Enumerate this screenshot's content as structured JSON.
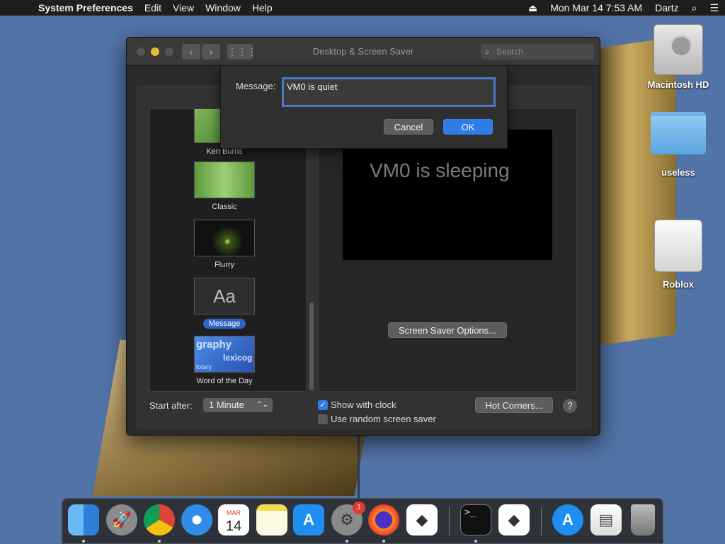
{
  "menubar": {
    "app_name": "System Preferences",
    "menus": [
      "Edit",
      "View",
      "Window",
      "Help"
    ],
    "datetime": "Mon Mar 14  7:53 AM",
    "user": "Dartz"
  },
  "window": {
    "title": "Desktop & Screen Saver",
    "search_placeholder": "Search"
  },
  "savers": [
    {
      "label": "Ken Burns"
    },
    {
      "label": "Classic"
    },
    {
      "label": "Flurry"
    },
    {
      "label": "Message",
      "thumb_text": "Aa",
      "selected": true
    },
    {
      "label": "Word of the Day",
      "thumb_words": [
        "graphy",
        "lexicog",
        "lotary"
      ]
    }
  ],
  "preview": {
    "text": "VM0 is sleeping"
  },
  "buttons": {
    "screen_saver_options": "Screen Saver Options...",
    "hot_corners": "Hot Corners...",
    "help": "?"
  },
  "start_after": {
    "label": "Start after:",
    "value": "1 Minute"
  },
  "checkboxes": {
    "show_clock": {
      "label": "Show with clock",
      "checked": true
    },
    "random": {
      "label": "Use random screen saver",
      "checked": false
    }
  },
  "message_sheet": {
    "label": "Message:",
    "value": "VM0 is quiet",
    "cancel": "Cancel",
    "ok": "OK"
  },
  "desktop_icons": [
    {
      "label": "Macintosh HD"
    },
    {
      "label": "useless"
    },
    {
      "label": "Roblox"
    }
  ],
  "dock": {
    "items": [
      "finder",
      "launchpad",
      "chrome",
      "safari",
      "calendar",
      "notes",
      "app-store",
      "system-preferences",
      "firefox",
      "roblox",
      "terminal",
      "roblox-studio",
      "app-store-download",
      "preview-doc",
      "trash"
    ],
    "calendar_month": "MAR",
    "calendar_day": "14",
    "sysprefs_badge": "1",
    "terminal_prompt": ">_"
  }
}
